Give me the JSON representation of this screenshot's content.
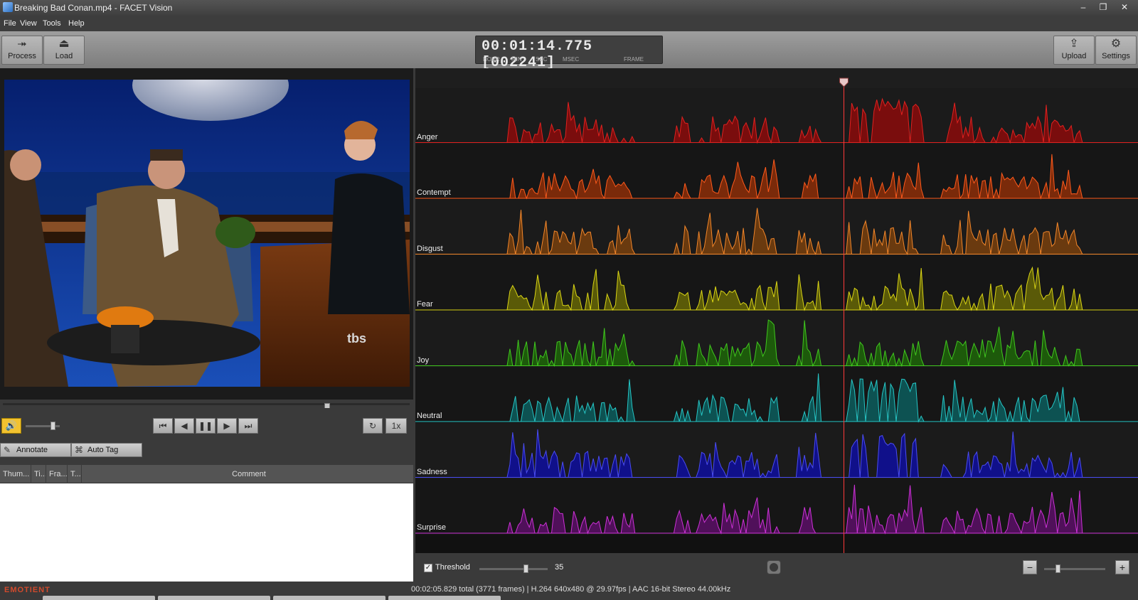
{
  "window": {
    "title": "Breaking Bad Conan.mp4 - FACET Vision",
    "minimize_glyph": "–",
    "restore_glyph": "❐",
    "close_glyph": "✕"
  },
  "menu": [
    "File",
    "View",
    "Tools",
    "Help"
  ],
  "toolbar": {
    "process_label": "Process",
    "load_label": "Load",
    "upload_label": "Upload",
    "settings_label": "Settings"
  },
  "timecode": {
    "display": "00:01:14.775 [002241]",
    "labels": [
      "HOUR",
      "MIN",
      "SEC",
      "MSEC",
      "FRAME"
    ]
  },
  "video": {
    "channel_logo": "tbs",
    "scrub_position": 0.8
  },
  "playback": {
    "volume_level": 0.85,
    "speed_label": "1x"
  },
  "annotation": {
    "annotate_label": "Annotate",
    "autotag_label": "Auto Tag"
  },
  "table": {
    "columns": [
      "Thum...",
      "Ti...",
      "Fra...",
      "T...",
      "Comment"
    ],
    "rows": []
  },
  "chart_data": {
    "type": "area",
    "title": "",
    "xlabel": "",
    "ylabel": "",
    "playhead_position": 0.593,
    "series": [
      {
        "name": "Anger",
        "color": "#e0211f",
        "fill": "#7a0d0d"
      },
      {
        "name": "Contempt",
        "color": "#ff5a1c",
        "fill": "#7a2a0a"
      },
      {
        "name": "Disgust",
        "color": "#f2862a",
        "fill": "#6a3a0f"
      },
      {
        "name": "Fear",
        "color": "#d9d415",
        "fill": "#5a5a08"
      },
      {
        "name": "Joy",
        "color": "#40c81e",
        "fill": "#1d5a0b"
      },
      {
        "name": "Neutral",
        "color": "#26c6c6",
        "fill": "#0d5252"
      },
      {
        "name": "Sadness",
        "color": "#4a4cf2",
        "fill": "#10108a"
      },
      {
        "name": "Surprise",
        "color": "#cc32d6",
        "fill": "#50105a"
      }
    ]
  },
  "threshold": {
    "enabled": true,
    "label": "Threshold",
    "value": "35",
    "slider_level": 0.7
  },
  "zoom": {
    "minus_label": "−",
    "plus_label": "+",
    "level": 0.2
  },
  "status": {
    "logo": "EMOTIENT",
    "text": "00:02:05.829 total (3771 frames) | H.264 640x480 @ 29.97fps | AAC 16-bit Stereo 44.00kHz"
  }
}
